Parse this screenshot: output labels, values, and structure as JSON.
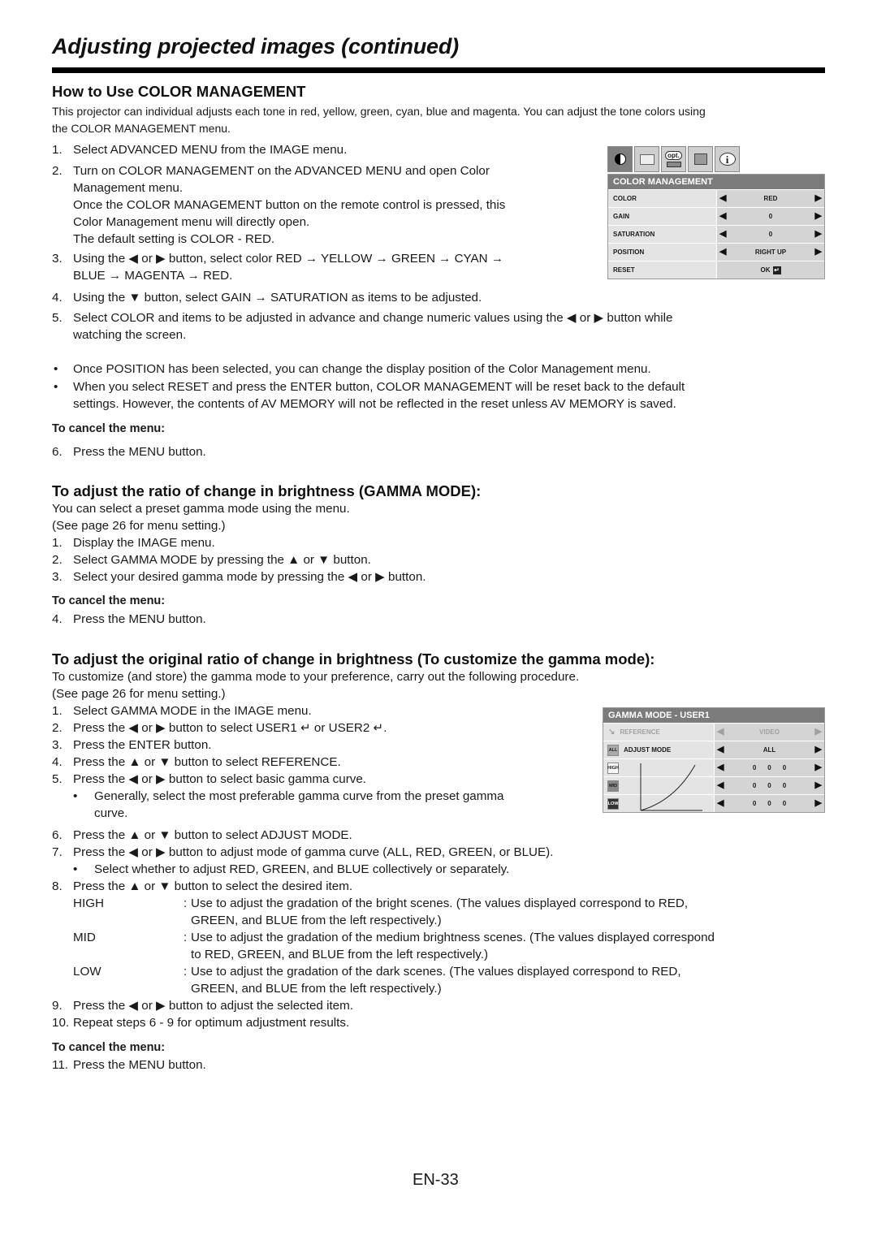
{
  "page": {
    "title": "Adjusting projected images (continued)",
    "page_number": "EN-33"
  },
  "section1": {
    "heading": "How to Use COLOR MANAGEMENT",
    "intro_line1": "This projector can individual adjusts each tone in red, yellow, green, cyan, blue and magenta. You can adjust the tone colors using",
    "intro_line2": "the COLOR MANAGEMENT menu.",
    "steps": [
      {
        "num": "1.",
        "lines": [
          "Select ADVANCED MENU from the IMAGE menu."
        ]
      },
      {
        "num": "2.",
        "lines": [
          "Turn on COLOR MANAGEMENT on the ADVANCED MENU and open Color",
          "Management menu.",
          "Once the COLOR MANAGEMENT button on the remote control is pressed, this",
          "Color Management menu will directly open.",
          "The default setting is COLOR - RED."
        ]
      },
      {
        "num": "3.",
        "lines": [
          "Using the ◀ or ▶ button, select color RED → YELLOW → GREEN → CYAN →",
          "BLUE → MAGENTA → RED."
        ]
      },
      {
        "num": "4.",
        "lines": [
          "Using the ▼ button, select GAIN → SATURATION as items to be adjusted."
        ]
      },
      {
        "num": "5.",
        "lines": [
          "Select COLOR and items to be adjusted in advance and change numeric values using the ◀ or ▶ button while",
          "watching the screen."
        ]
      }
    ],
    "bullets": [
      {
        "lines": [
          "Once POSITION has been selected, you can change the display position of the Color Management menu."
        ]
      },
      {
        "lines": [
          "When you select RESET and press the ENTER button, COLOR MANAGEMENT will be reset back to the default",
          "settings. However, the contents of AV MEMORY will not be reflected in the reset unless AV MEMORY is saved."
        ]
      }
    ],
    "cancel_heading": "To cancel the menu:",
    "cancel_step": {
      "num": "6.",
      "text": "Press the MENU button."
    }
  },
  "color_menu": {
    "tabs": [
      "picture-icon",
      "projector-screen-icon",
      "opt-icon",
      "installation-icon",
      "info-icon"
    ],
    "opt_label": "opt.",
    "info_label": "i",
    "title": "COLOR MANAGEMENT",
    "rows": [
      {
        "label": "COLOR",
        "value": "RED"
      },
      {
        "label": "GAIN",
        "value": "0"
      },
      {
        "label": "SATURATION",
        "value": "0"
      },
      {
        "label": "POSITION",
        "value": "RIGHT UP"
      },
      {
        "label": "RESET",
        "value": "OK"
      }
    ]
  },
  "section2": {
    "heading": "To adjust the ratio of change in brightness (GAMMA MODE):",
    "intro_line1": "You can select a preset gamma mode using the menu.",
    "intro_line2": "(See page 26 for menu setting.)",
    "steps": [
      {
        "num": "1.",
        "text": "Display the IMAGE menu."
      },
      {
        "num": "2.",
        "text": "Select GAMMA MODE by pressing the ▲ or ▼ button."
      },
      {
        "num": "3.",
        "text": "Select your desired gamma mode by pressing the ◀ or ▶ button."
      }
    ],
    "cancel_heading": "To cancel the menu:",
    "cancel_step": {
      "num": "4.",
      "text": "Press the MENU button."
    }
  },
  "section3": {
    "heading": "To adjust the original ratio of change in brightness (To customize the gamma mode):",
    "intro_line1": "To customize (and store) the gamma mode to your preference, carry out the following procedure.",
    "intro_line2": "(See page 26 for menu setting.)",
    "steps": [
      {
        "num": "1.",
        "text": "Select GAMMA MODE in the IMAGE menu."
      },
      {
        "num": "2.",
        "text": "Press the ◀ or ▶ button to select USER1 ↵ or USER2 ↵."
      },
      {
        "num": "3.",
        "text": "Press the ENTER button."
      },
      {
        "num": "4.",
        "text": "Press the ▲ or ▼ button to select REFERENCE."
      },
      {
        "num": "5.",
        "text": "Press the ◀ or ▶ button to select basic gamma curve."
      },
      {
        "num": "6.",
        "text": "Press the ▲ or ▼ button to select ADJUST MODE."
      },
      {
        "num": "7.",
        "text": "Press the ◀ or ▶ button to adjust mode of gamma curve (ALL, RED, GREEN, or BLUE)."
      },
      {
        "num": "8.",
        "text": "Press the ▲ or ▼ button to select the desired item."
      },
      {
        "num": "9.",
        "text": "Press the ◀ or ▶ button to adjust the selected item."
      },
      {
        "num": "10.",
        "text": "Repeat steps 6 - 9 for optimum adjustment results."
      }
    ],
    "step5_bullet": [
      "Generally, select the most preferable gamma curve from the preset gamma",
      "curve."
    ],
    "step7_bullet": "Select whether to adjust RED, GREEN, and BLUE collectively or separately.",
    "items": [
      {
        "term": "HIGH",
        "lines": [
          "Use to adjust the gradation of the bright scenes. (The values displayed correspond to RED,",
          "GREEN, and BLUE from the left respectively.)"
        ]
      },
      {
        "term": "MID",
        "lines": [
          "Use to adjust the gradation of the medium brightness scenes. (The values displayed correspond",
          "to RED, GREEN, and BLUE from the left respectively.)"
        ]
      },
      {
        "term": "LOW",
        "lines": [
          "Use to adjust the gradation of the dark scenes. (The values displayed correspond to RED,",
          "GREEN, and BLUE from the left respectively.)"
        ]
      }
    ],
    "cancel_heading": "To cancel the menu:",
    "cancel_step": {
      "num": "11.",
      "text": "Press the MENU button."
    }
  },
  "gamma_menu": {
    "title": "GAMMA MODE - USER1",
    "reference": {
      "label": "REFERENCE",
      "value": "VIDEO"
    },
    "adjust_mode": {
      "label": "ADJUST MODE",
      "value": "ALL",
      "icon_text": "ALL"
    },
    "levels": [
      {
        "label": "HIGH",
        "icon_text": "HIGH",
        "values": [
          "0",
          "0",
          "0"
        ]
      },
      {
        "label": "MID",
        "icon_text": "MID",
        "values": [
          "0",
          "0",
          "0"
        ]
      },
      {
        "label": "LOW",
        "icon_text": "LOW",
        "values": [
          "0",
          "0",
          "0"
        ]
      }
    ]
  }
}
